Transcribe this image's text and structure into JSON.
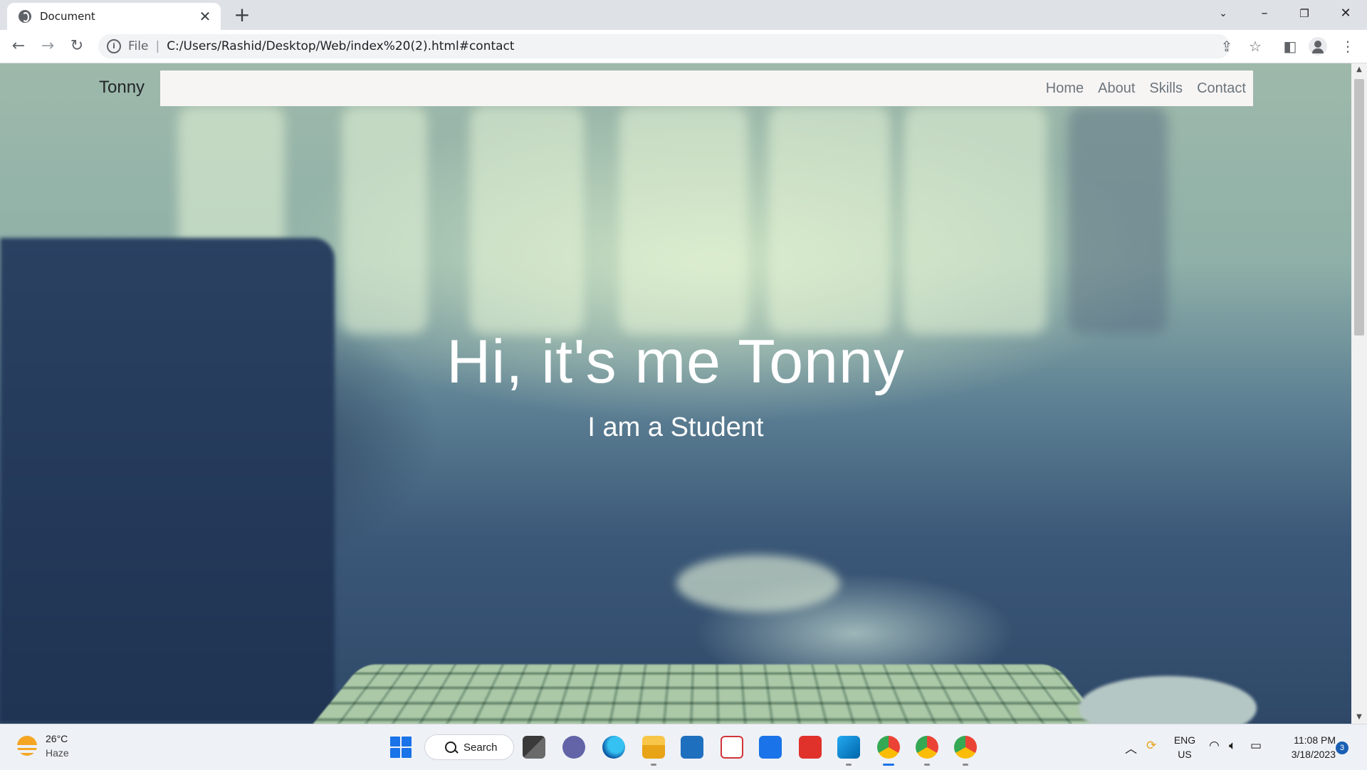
{
  "browser": {
    "tab_title": "Document",
    "close_tab": "✕",
    "new_tab": "+",
    "scheme_label": "File",
    "url": "C:/Users/Rashid/Desktop/Web/index%20(2).html#contact"
  },
  "site": {
    "brand": "Tonny",
    "nav": [
      "Home",
      "About",
      "Skills",
      "Contact"
    ],
    "hero_title": "Hi, it's me Tonny",
    "hero_subtitle": "I am a Student"
  },
  "taskbar": {
    "weather_temp": "26°C",
    "weather_condition": "Haze",
    "search_label": "Search",
    "lang_primary": "ENG",
    "lang_region": "US",
    "time": "11:08 PM",
    "date": "3/18/2023",
    "notification_count": "3"
  },
  "colors": {
    "nav_background": "#f7f5f4",
    "nav_link": "#6c757d",
    "accent": "#1a73e8"
  }
}
